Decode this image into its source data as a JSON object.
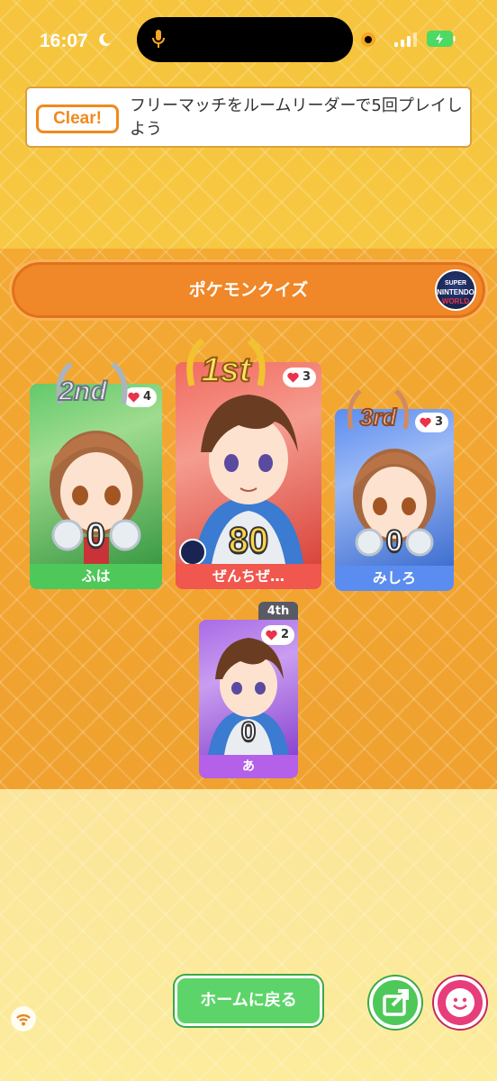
{
  "status_bar": {
    "time": "16:07"
  },
  "mission": {
    "badge": "Clear!",
    "text": "フリーマッチをルームリーダーで5回プレイしよう"
  },
  "quiz": {
    "title": "ポケモンクイズ",
    "logo_text": [
      "SUPER",
      "NINTENDO",
      "WORLD"
    ]
  },
  "players": [
    {
      "rank": "2nd",
      "name": "ふは",
      "score": "0",
      "hearts": "4",
      "bar_color": "#4fc85a"
    },
    {
      "rank": "1st",
      "name": "ぜんちぜ…",
      "score": "80",
      "hearts": "3",
      "bar_color": "#f0574f"
    },
    {
      "rank": "3rd",
      "name": "みしろ",
      "score": "0",
      "hearts": "3",
      "bar_color": "#5b8df0"
    },
    {
      "rank": "4th",
      "name": "あ",
      "score": "0",
      "hearts": "2",
      "bar_color": "#b460e8"
    }
  ],
  "buttons": {
    "home": "ホームに戻る"
  },
  "colors": {
    "accent_orange": "#f08728",
    "heart_red": "#e8334a"
  }
}
